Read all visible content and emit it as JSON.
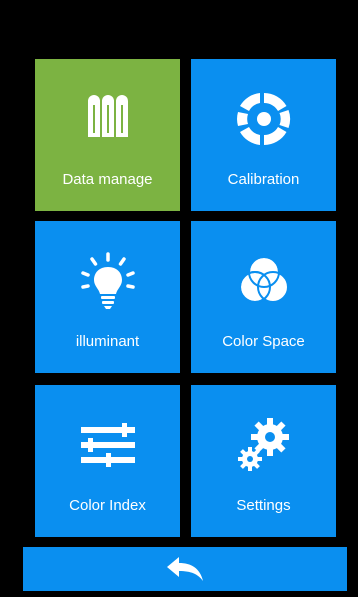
{
  "colors": {
    "background": "#000000",
    "tile": "#0a8ff0",
    "tile_active": "#7cb342",
    "text": "#ffffff"
  },
  "menu": {
    "tiles": [
      {
        "label": "Data manage",
        "icon": "data-manage-icon",
        "active": true
      },
      {
        "label": "Calibration",
        "icon": "calibration-icon",
        "active": false
      },
      {
        "label": "illuminant",
        "icon": "lightbulb-icon",
        "active": false
      },
      {
        "label": "Color Space",
        "icon": "color-space-icon",
        "active": false
      },
      {
        "label": "Color Index",
        "icon": "sliders-icon",
        "active": false
      },
      {
        "label": "Settings",
        "icon": "gears-icon",
        "active": false
      }
    ]
  },
  "footer": {
    "back_icon": "back-arrow-icon"
  }
}
